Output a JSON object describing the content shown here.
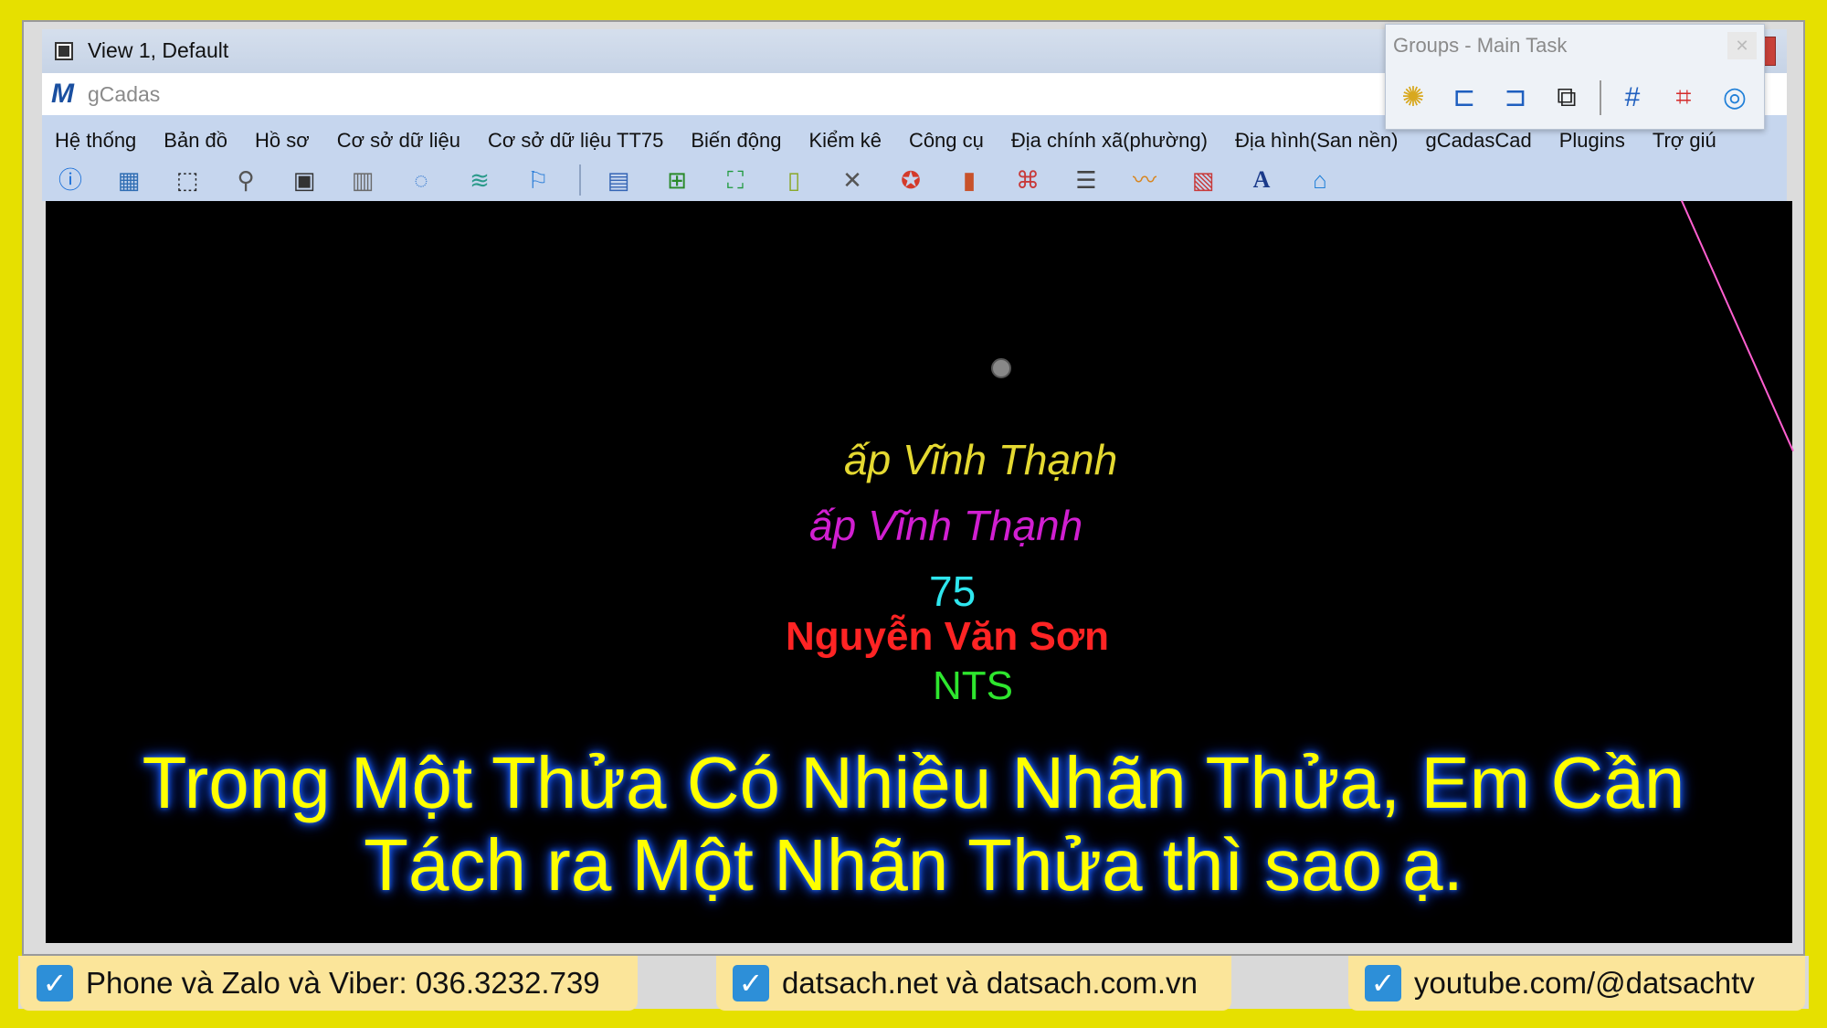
{
  "window": {
    "title": "View 1, Default",
    "app_name": "gCadas"
  },
  "menu": [
    "Hệ thống",
    "Bản đồ",
    "Hồ sơ",
    "Cơ sở dữ liệu",
    "Cơ sở dữ liệu TT75",
    "Biến động",
    "Kiểm kê",
    "Công cụ",
    "Địa chính xã(phường)",
    "Địa hình(San nền)",
    "gCadasCad",
    "Plugins",
    "Trợ giú"
  ],
  "toolbar_icons": [
    "info-icon",
    "table-icon",
    "polygon-select-icon",
    "search-tool-icon",
    "frame-icon",
    "grid-icon",
    "hide-icon",
    "layer-delete-icon",
    "marker-icon",
    "separator",
    "document-edit-icon",
    "edit-node-icon",
    "map-icon",
    "columns-icon",
    "tools-icon",
    "refresh-icon",
    "bars-icon",
    "network-icon",
    "list-icon",
    "chart-icon",
    "delete-report-icon",
    "font-icon",
    "home-upload-icon"
  ],
  "panel": {
    "title": "Groups - Main Task",
    "icons": [
      "light-icon",
      "draw-line-icon",
      "draw-polyline-icon",
      "shape-icon",
      "separator",
      "grid-hash-icon",
      "grid-cross-icon",
      "target-icon"
    ]
  },
  "canvas": {
    "labels": [
      "ấp Vĩnh Thạnh",
      "ấp Vĩnh Thạnh",
      "75",
      "Nguyễn Văn Sơn",
      "NTS"
    ]
  },
  "overlay": {
    "line1": "Trong Một Thửa Có Nhiều Nhãn Thửa, Em Cần",
    "line2": "Tách ra Một Nhãn Thửa thì sao ạ."
  },
  "footer": {
    "items": [
      "Phone và Zalo và Viber: 036.3232.739",
      "datsach.net và datsach.com.vn",
      "youtube.com/@datsachtv"
    ]
  },
  "colors": {
    "background": "#e6e000",
    "label_yellow": "#e5d931",
    "label_magenta": "#d11fd1",
    "label_cyan": "#2ee6ee",
    "label_red": "#ff2424",
    "label_green": "#2ee62e",
    "overlay_text": "#ffff00"
  }
}
